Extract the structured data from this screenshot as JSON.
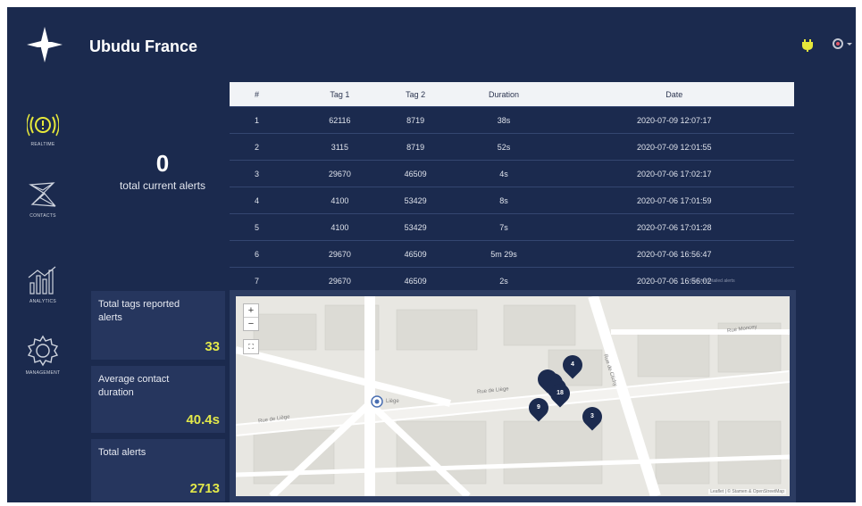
{
  "app": {
    "title": "Ubudu France"
  },
  "sidebar": {
    "items": [
      {
        "label": "REALTIME",
        "icon": "realtime-alert-icon"
      },
      {
        "label": "CONTACTS",
        "icon": "contacts-network-icon"
      },
      {
        "label": "ANALYTICS",
        "icon": "analytics-chart-icon"
      },
      {
        "label": "MANAGEMENT",
        "icon": "gear-icon"
      }
    ]
  },
  "summary": {
    "current_alerts_value": "0",
    "current_alerts_label": "total current alerts"
  },
  "stats": [
    {
      "label": "Total tags reported alerts",
      "value": "33"
    },
    {
      "label": "Average contact duration",
      "value": "40.4s"
    },
    {
      "label": "Total alerts",
      "value": "2713"
    }
  ],
  "table": {
    "headers": [
      "#",
      "Tag 1",
      "Tag 2",
      "Duration",
      "Date"
    ],
    "rows": [
      [
        "1",
        "62116",
        "8719",
        "38s",
        "2020-07-09 12:07:17"
      ],
      [
        "2",
        "3115",
        "8719",
        "52s",
        "2020-07-09 12:01:55"
      ],
      [
        "3",
        "29670",
        "46509",
        "4s",
        "2020-07-06 17:02:17"
      ],
      [
        "4",
        "4100",
        "53429",
        "8s",
        "2020-07-06 17:01:59"
      ],
      [
        "5",
        "4100",
        "53429",
        "7s",
        "2020-07-06 17:01:28"
      ],
      [
        "6",
        "29670",
        "46509",
        "5m 29s",
        "2020-07-06 16:56:47"
      ],
      [
        "7",
        "29670",
        "46509",
        "2s",
        "2020-07-06 16:56:02"
      ]
    ],
    "footer_note": "Click for detailed alerts"
  },
  "map": {
    "zoom_in": "+",
    "zoom_out": "−",
    "streets": {
      "rue_de_liege": "Rue de Liège",
      "rue_de_liege_west": "Rue de Liège",
      "rue_de_clichy": "Rue de Clichy",
      "rue_moncey": "Rue Moncey",
      "metro": "Liège"
    },
    "markers": [
      "4",
      "18",
      "9",
      "3"
    ],
    "attribution": "Leaflet | © Stamen & OpenStreetMap"
  },
  "colors": {
    "background": "#1b2a4e",
    "panel": "#22325a",
    "accent_value": "#e2e84a",
    "marker": "#1c2b4f"
  }
}
